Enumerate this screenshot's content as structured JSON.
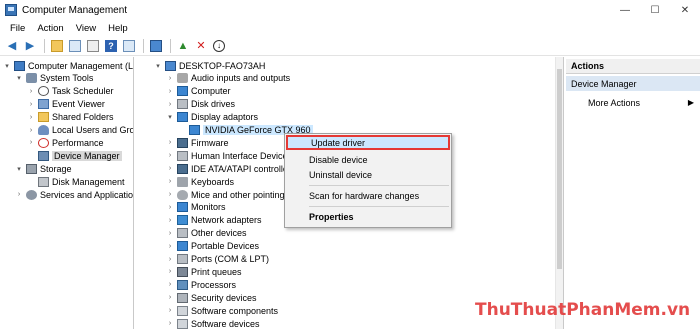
{
  "window": {
    "title": "Computer Management",
    "min": "—",
    "max": "☐",
    "close": "✕"
  },
  "menu": [
    "File",
    "Action",
    "View",
    "Help"
  ],
  "toolbar": {
    "icons": [
      "back-icon",
      "forward-icon",
      "up-folder-icon",
      "show-hide-tree-icon",
      "properties-icon",
      "help-icon",
      "panel-icon",
      "monitor-icon",
      "update-driver-icon",
      "uninstall-icon",
      "download-icon"
    ]
  },
  "left_tree": [
    {
      "label": "Computer Management (Local",
      "level": 0,
      "expander": "▾",
      "icon": "computer"
    },
    {
      "label": "System Tools",
      "level": 1,
      "expander": "▾",
      "icon": "tools"
    },
    {
      "label": "Task Scheduler",
      "level": 2,
      "expander": "›",
      "icon": "clock"
    },
    {
      "label": "Event Viewer",
      "level": 2,
      "expander": "›",
      "icon": "event"
    },
    {
      "label": "Shared Folders",
      "level": 2,
      "expander": "›",
      "icon": "folder"
    },
    {
      "label": "Local Users and Groups",
      "level": 2,
      "expander": "›",
      "icon": "users"
    },
    {
      "label": "Performance",
      "level": 2,
      "expander": "›",
      "icon": "perf"
    },
    {
      "label": "Device Manager",
      "level": 2,
      "expander": "",
      "icon": "device",
      "selected": true
    },
    {
      "label": "Storage",
      "level": 1,
      "expander": "▾",
      "icon": "storage"
    },
    {
      "label": "Disk Management",
      "level": 2,
      "expander": "",
      "icon": "disk"
    },
    {
      "label": "Services and Applications",
      "level": 1,
      "expander": "›",
      "icon": "services"
    }
  ],
  "device_tree": [
    {
      "label": "DESKTOP-FAO73AH",
      "level": 0,
      "expander": "▾",
      "icon": "desktop"
    },
    {
      "label": "Audio inputs and outputs",
      "level": 1,
      "expander": "›",
      "icon": "audio"
    },
    {
      "label": "Computer",
      "level": 1,
      "expander": "›",
      "icon": "monitor"
    },
    {
      "label": "Disk drives",
      "level": 1,
      "expander": "›",
      "icon": "gray"
    },
    {
      "label": "Display adaptors",
      "level": 1,
      "expander": "▾",
      "icon": "monitor"
    },
    {
      "label": "NVIDIA GeForce GTX 960",
      "level": 2,
      "expander": "",
      "icon": "monitor",
      "selected": true
    },
    {
      "label": "Firmware",
      "level": 1,
      "expander": "›",
      "icon": "chip"
    },
    {
      "label": "Human Interface Devices",
      "level": 1,
      "expander": "›",
      "icon": "gray"
    },
    {
      "label": "IDE ATA/ATAPI controllers",
      "level": 1,
      "expander": "›",
      "icon": "chip"
    },
    {
      "label": "Keyboards",
      "level": 1,
      "expander": "›",
      "icon": "keyboard"
    },
    {
      "label": "Mice and other pointing de",
      "level": 1,
      "expander": "›",
      "icon": "mouse"
    },
    {
      "label": "Monitors",
      "level": 1,
      "expander": "›",
      "icon": "monitor"
    },
    {
      "label": "Network adapters",
      "level": 1,
      "expander": "›",
      "icon": "net"
    },
    {
      "label": "Other devices",
      "level": 1,
      "expander": "›",
      "icon": "gray"
    },
    {
      "label": "Portable Devices",
      "level": 1,
      "expander": "›",
      "icon": "monitor"
    },
    {
      "label": "Ports (COM & LPT)",
      "level": 1,
      "expander": "›",
      "icon": "gray"
    },
    {
      "label": "Print queues",
      "level": 1,
      "expander": "›",
      "icon": "printer"
    },
    {
      "label": "Processors",
      "level": 1,
      "expander": "›",
      "icon": "cpu"
    },
    {
      "label": "Security devices",
      "level": 1,
      "expander": "›",
      "icon": "security"
    },
    {
      "label": "Software components",
      "level": 1,
      "expander": "›",
      "icon": "software"
    },
    {
      "label": "Software devices",
      "level": 1,
      "expander": "›",
      "icon": "software"
    }
  ],
  "context_menu": {
    "update": "Update driver",
    "disable": "Disable device",
    "uninstall": "Uninstall device",
    "scan": "Scan for hardware changes",
    "properties": "Properties"
  },
  "actions": {
    "header": "Actions",
    "section": "Device Manager",
    "more": "More Actions",
    "more_arrow": "▶"
  },
  "watermark": "ThuThuatPhanMem.vn",
  "colors": {
    "selection": "#cce8ff",
    "highlight_border": "#e53935",
    "watermark": "#e23a3a"
  }
}
